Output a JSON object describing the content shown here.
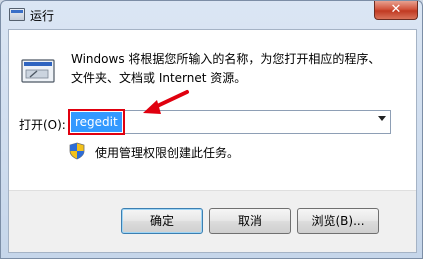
{
  "window": {
    "title": "运行",
    "close_glyph": "✕"
  },
  "description": {
    "line1": "Windows 将根据您所输入的名称，为您打开相应的程序、",
    "line2": "文件夹、文档或 Internet 资源。"
  },
  "open_field": {
    "label": "打开(O):",
    "value": "regedit"
  },
  "admin_note": "使用管理权限创建此任务。",
  "buttons": {
    "ok": "确定",
    "cancel": "取消",
    "browse": "浏览(B)..."
  },
  "colors": {
    "annotation": "#e0000f",
    "selection": "#3399ff"
  }
}
